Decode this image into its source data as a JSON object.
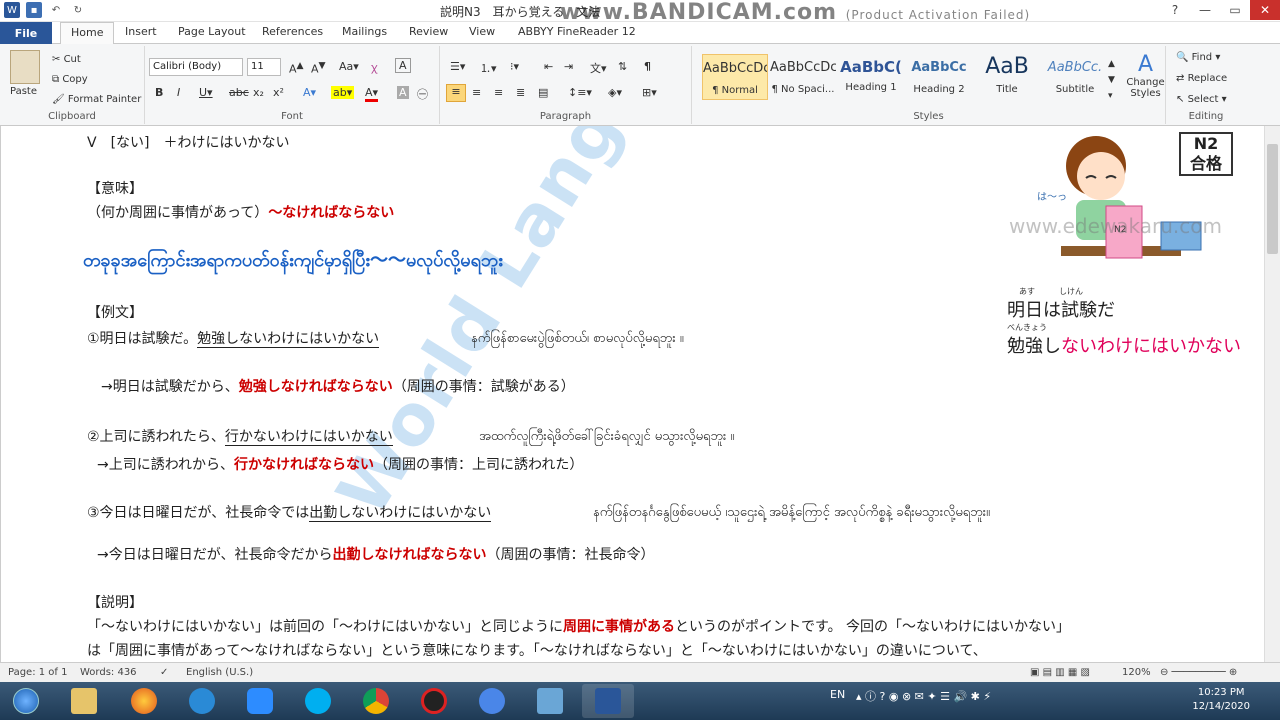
{
  "window": {
    "title": "説明N3　耳から覚える　文法",
    "bandicam": "www.BANDICAM.com",
    "bandicam_note": "(Product Activation Failed)"
  },
  "tabs": [
    "File",
    "Home",
    "Insert",
    "Page Layout",
    "References",
    "Mailings",
    "Review",
    "View",
    "ABBYY FineReader 12"
  ],
  "ribbon": {
    "clipboard": {
      "paste": "Paste",
      "cut": "Cut",
      "copy": "Copy",
      "format_painter": "Format Painter",
      "label": "Clipboard"
    },
    "font": {
      "name": "Calibri (Body)",
      "size": "11",
      "label": "Font"
    },
    "paragraph": {
      "label": "Paragraph"
    },
    "styles": {
      "label": "Styles",
      "items": [
        {
          "preview": "AaBbCcDc",
          "name": "¶ Normal"
        },
        {
          "preview": "AaBbCcDc",
          "name": "¶ No Spaci..."
        },
        {
          "preview": "AaBbC(",
          "name": "Heading 1"
        },
        {
          "preview": "AaBbCc",
          "name": "Heading 2"
        },
        {
          "preview": "AaB",
          "name": "Title"
        },
        {
          "preview": "AaBbCc.",
          "name": "Subtitle"
        }
      ],
      "change_styles": "Change Styles"
    },
    "editing": {
      "find": "Find",
      "replace": "Replace",
      "select": "Select",
      "label": "Editing"
    }
  },
  "document": {
    "line1": "V　[ない]　＋わけにはいかない",
    "imi_head": "【意味】",
    "imi_text": "（何か周囲に事情があって）",
    "imi_red": "～なければならない",
    "burmese_title": "တခုခုအကြောင်းအရာကပတ်ဝန်းကျင်မှာရှိပြီး～～မလုပ်လို့မရဘူး",
    "reibun": "【例文】",
    "ex1_a": "①明日は試験だ。",
    "ex1_b": "勉強しないわけにはいかない",
    "ex1_my": "နက်ဖြန်စာမေးပွဲဖြစ်တယ်၊ စာမလုပ်လို့မရဘူး ။",
    "ex1_arrow": "→明日は試験だから、",
    "ex1_red": "勉強しなければならない",
    "ex1_note": "（周囲の事情：試験がある）",
    "ex2_a": "②上司に誘われたら、",
    "ex2_b": "行かないわけにはいかない",
    "ex2_my": "အထက်လူကြီးရဲ့ဖိတ်ခေါ်ခြင်းခံရလျှင် မသွားလို့မရဘူး ။",
    "ex2_arrow": "→上司に誘われから、",
    "ex2_red": "行かなければならない",
    "ex2_note": "（周囲の事情：上司に誘われた）",
    "ex3_a": "③今日は日曜日だが、社長命令では",
    "ex3_b": "出勤しないわけにはいかない",
    "ex3_my": "နက်ဖြန်တနင်္ဂနွေဖြစ်ပေမယ့် ၊သူဌေးရဲ့ အမိန့်ကြောင့် အလုပ်ကိစ္စနဲ့ ခရီးမသွားလို့မရဘူး။",
    "ex3_arrow": "→今日は日曜日だが、社長命令だから",
    "ex3_red": "出勤しなければならない",
    "ex3_note": "（周囲の事情：社長命令）",
    "setsumei": "【説明】",
    "setsumei_a": "「～ないわけにはいかない」は前回の「～わけにはいかない」と同じように",
    "setsumei_red": "周囲に事情がある",
    "setsumei_b": "というのがポイントです。 今回の「～ないわけにはいかない」",
    "setsumei_c": "は「周囲に事情があって～なければならない」という意味になります。「～なければならない」と「～ないわけにはいかない」の違いについて、",
    "img_badge_1": "N2",
    "img_badge_2": "合格",
    "img_site": "www.edewakaru.com",
    "img_ruby1": "あす　　　しけん",
    "img_line1": "明日は試験だ",
    "img_ruby2": "べんきょう",
    "img_line2_a": "勉強し",
    "img_line2_b": "ないわけにはいかない",
    "watermark": "World Language Center"
  },
  "status": {
    "page": "Page: 1 of 1",
    "words": "Words: 436",
    "lang": "English (U.S.)",
    "zoom": "120%"
  },
  "taskbar": {
    "lang": "EN",
    "time": "10:23 PM",
    "date": "12/14/2020"
  }
}
